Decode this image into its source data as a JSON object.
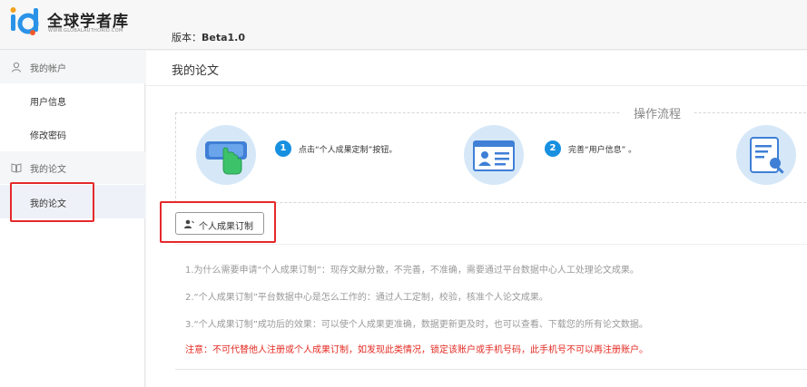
{
  "header": {
    "brand_name": "全球学者库",
    "brand_sub": "WWW.GLOBALAUTHORID.COM",
    "version_label": "版本：",
    "version_value": "Beta1.0"
  },
  "sidebar": {
    "groups": [
      {
        "label": "我的帐户",
        "icon": "user-icon",
        "items": [
          "用户信息",
          "修改密码"
        ]
      },
      {
        "label": "我的论文",
        "icon": "book-icon",
        "items": [
          "我的论文"
        ]
      }
    ]
  },
  "main": {
    "page_title": "我的论文",
    "flow_title": "操作流程",
    "steps": [
      {
        "num": "1",
        "text": "点击“个人成果定制”按钮。"
      },
      {
        "num": "2",
        "text": "完善“用户信息” 。"
      }
    ],
    "custom_button": "个人成果订制",
    "faq": [
      "1.为什么需要申请“个人成果订制”：现存文献分散，不完善，不准确，需要通过平台数据中心人工处理论文成果。",
      "2.“个人成果订制”平台数据中心是怎么工作的：通过人工定制，校验，核准个人论文成果。",
      "3.“个人成果订制”成功后的效果：可以使个人成果更准确，数据更新更及时，也可以查看、下载您的所有论文数据。"
    ],
    "warning": "注意：不可代替他人注册或个人成果订制，如发现此类情况，锁定该账户或手机号码，此手机号不可以再注册账户。"
  },
  "colors": {
    "accent_blue": "#1890e0",
    "highlight_red": "#e5292b",
    "warning_red": "#e32a22"
  }
}
